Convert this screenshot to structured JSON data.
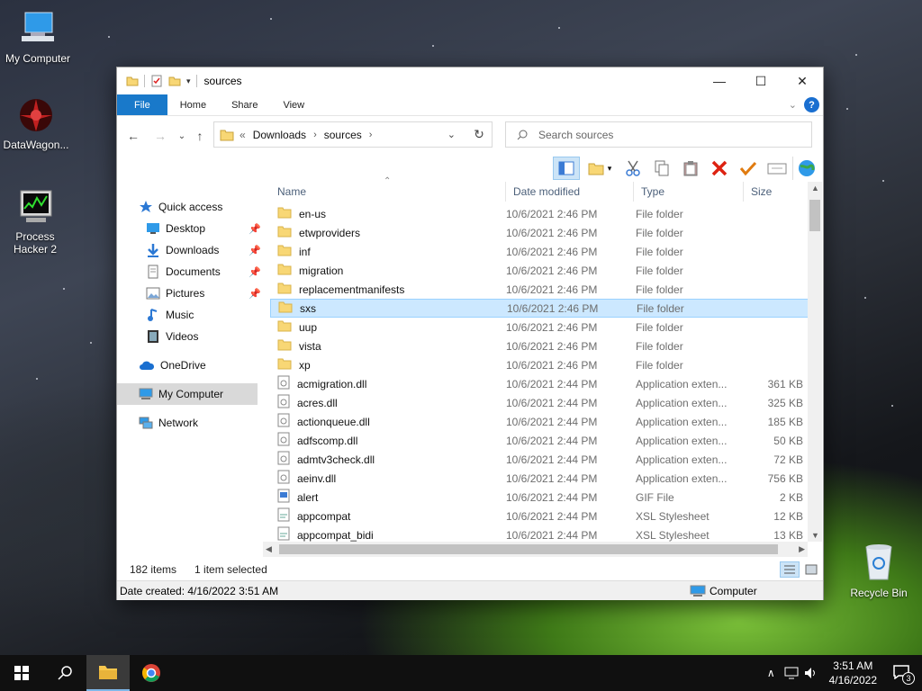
{
  "desktop": {
    "icons": [
      {
        "label": "My Computer"
      },
      {
        "label": "DataWagon..."
      },
      {
        "label": "Process Hacker 2"
      },
      {
        "label": "Recycle Bin"
      }
    ]
  },
  "window": {
    "title": "sources",
    "controls": {
      "minimize": "—",
      "maximize": "☐",
      "close": "✕"
    },
    "ribbon_tabs": [
      "File",
      "Home",
      "Share",
      "View"
    ],
    "help": "?",
    "address": {
      "overflow": "«",
      "crumbs": [
        "Downloads",
        "sources"
      ]
    },
    "search_placeholder": "Search sources",
    "sidebar": [
      {
        "label": "Quick access",
        "icon": "star-icon"
      },
      {
        "label": "Desktop",
        "icon": "desktop-icon",
        "pinned": true
      },
      {
        "label": "Downloads",
        "icon": "download-icon",
        "pinned": true
      },
      {
        "label": "Documents",
        "icon": "documents-icon",
        "pinned": true
      },
      {
        "label": "Pictures",
        "icon": "pictures-icon",
        "pinned": true
      },
      {
        "label": "Music",
        "icon": "music-icon"
      },
      {
        "label": "Videos",
        "icon": "videos-icon"
      },
      {
        "label": "OneDrive",
        "icon": "cloud-icon"
      },
      {
        "label": "My Computer",
        "icon": "computer-icon",
        "selected": true
      },
      {
        "label": "Network",
        "icon": "network-icon"
      }
    ],
    "columns": [
      "Name",
      "Date modified",
      "Type",
      "Size"
    ],
    "files": [
      {
        "name": "en-us",
        "date": "10/6/2021 2:46 PM",
        "type": "File folder",
        "size": "",
        "kind": "folder"
      },
      {
        "name": "etwproviders",
        "date": "10/6/2021 2:46 PM",
        "type": "File folder",
        "size": "",
        "kind": "folder"
      },
      {
        "name": "inf",
        "date": "10/6/2021 2:46 PM",
        "type": "File folder",
        "size": "",
        "kind": "folder"
      },
      {
        "name": "migration",
        "date": "10/6/2021 2:46 PM",
        "type": "File folder",
        "size": "",
        "kind": "folder"
      },
      {
        "name": "replacementmanifests",
        "date": "10/6/2021 2:46 PM",
        "type": "File folder",
        "size": "",
        "kind": "folder"
      },
      {
        "name": "sxs",
        "date": "10/6/2021 2:46 PM",
        "type": "File folder",
        "size": "",
        "kind": "folder",
        "selected": true
      },
      {
        "name": "uup",
        "date": "10/6/2021 2:46 PM",
        "type": "File folder",
        "size": "",
        "kind": "folder"
      },
      {
        "name": "vista",
        "date": "10/6/2021 2:46 PM",
        "type": "File folder",
        "size": "",
        "kind": "folder"
      },
      {
        "name": "xp",
        "date": "10/6/2021 2:46 PM",
        "type": "File folder",
        "size": "",
        "kind": "folder"
      },
      {
        "name": "acmigration.dll",
        "date": "10/6/2021 2:44 PM",
        "type": "Application exten...",
        "size": "361 KB",
        "kind": "dll"
      },
      {
        "name": "acres.dll",
        "date": "10/6/2021 2:44 PM",
        "type": "Application exten...",
        "size": "325 KB",
        "kind": "dll"
      },
      {
        "name": "actionqueue.dll",
        "date": "10/6/2021 2:44 PM",
        "type": "Application exten...",
        "size": "185 KB",
        "kind": "dll"
      },
      {
        "name": "adfscomp.dll",
        "date": "10/6/2021 2:44 PM",
        "type": "Application exten...",
        "size": "50 KB",
        "kind": "dll"
      },
      {
        "name": "admtv3check.dll",
        "date": "10/6/2021 2:44 PM",
        "type": "Application exten...",
        "size": "72 KB",
        "kind": "dll"
      },
      {
        "name": "aeinv.dll",
        "date": "10/6/2021 2:44 PM",
        "type": "Application exten...",
        "size": "756 KB",
        "kind": "dll"
      },
      {
        "name": "alert",
        "date": "10/6/2021 2:44 PM",
        "type": "GIF File",
        "size": "2 KB",
        "kind": "image"
      },
      {
        "name": "appcompat",
        "date": "10/6/2021 2:44 PM",
        "type": "XSL Stylesheet",
        "size": "12 KB",
        "kind": "xsl"
      },
      {
        "name": "appcompat_bidi",
        "date": "10/6/2021 2:44 PM",
        "type": "XSL Stylesheet",
        "size": "13 KB",
        "kind": "xsl"
      }
    ],
    "status": {
      "count": "182 items",
      "selection": "1 item selected"
    },
    "details": {
      "created": "Date created: 4/16/2022 3:51 AM",
      "location": "Computer"
    }
  },
  "taskbar": {
    "time": "3:51 AM",
    "date": "4/16/2022",
    "notifications": "3"
  },
  "colors": {
    "accent": "#1979ca",
    "selection": "#cce8ff",
    "folder": "#f8d775"
  }
}
